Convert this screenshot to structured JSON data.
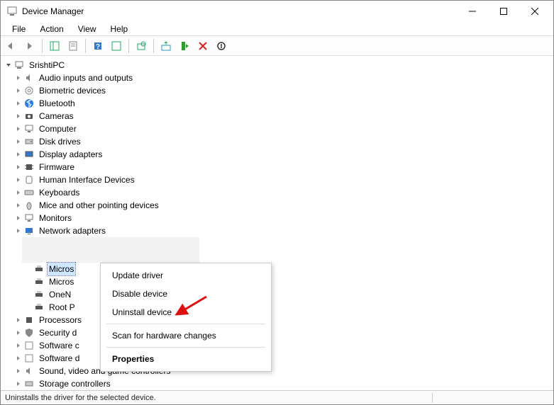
{
  "window": {
    "title": "Device Manager"
  },
  "menu": {
    "file": "File",
    "action": "Action",
    "view": "View",
    "help": "Help"
  },
  "tree": {
    "root": "SrishtiPC",
    "items": [
      "Audio inputs and outputs",
      "Biometric devices",
      "Bluetooth",
      "Cameras",
      "Computer",
      "Disk drives",
      "Display adapters",
      "Firmware",
      "Human Interface Devices",
      "Keyboards",
      "Mice and other pointing devices",
      "Monitors",
      "Network adapters"
    ],
    "q_children": [
      "Micros",
      "Micros",
      "OneN",
      "Root P"
    ],
    "rest": [
      "Processors",
      "Security d",
      "Software c",
      "Software d",
      "Sound, video and game controllers",
      "Storage controllers"
    ]
  },
  "context": {
    "update": "Update driver",
    "disable": "Disable device",
    "uninstall": "Uninstall device",
    "scan": "Scan for hardware changes",
    "props": "Properties"
  },
  "status": {
    "text": "Uninstalls the driver for the selected device."
  }
}
